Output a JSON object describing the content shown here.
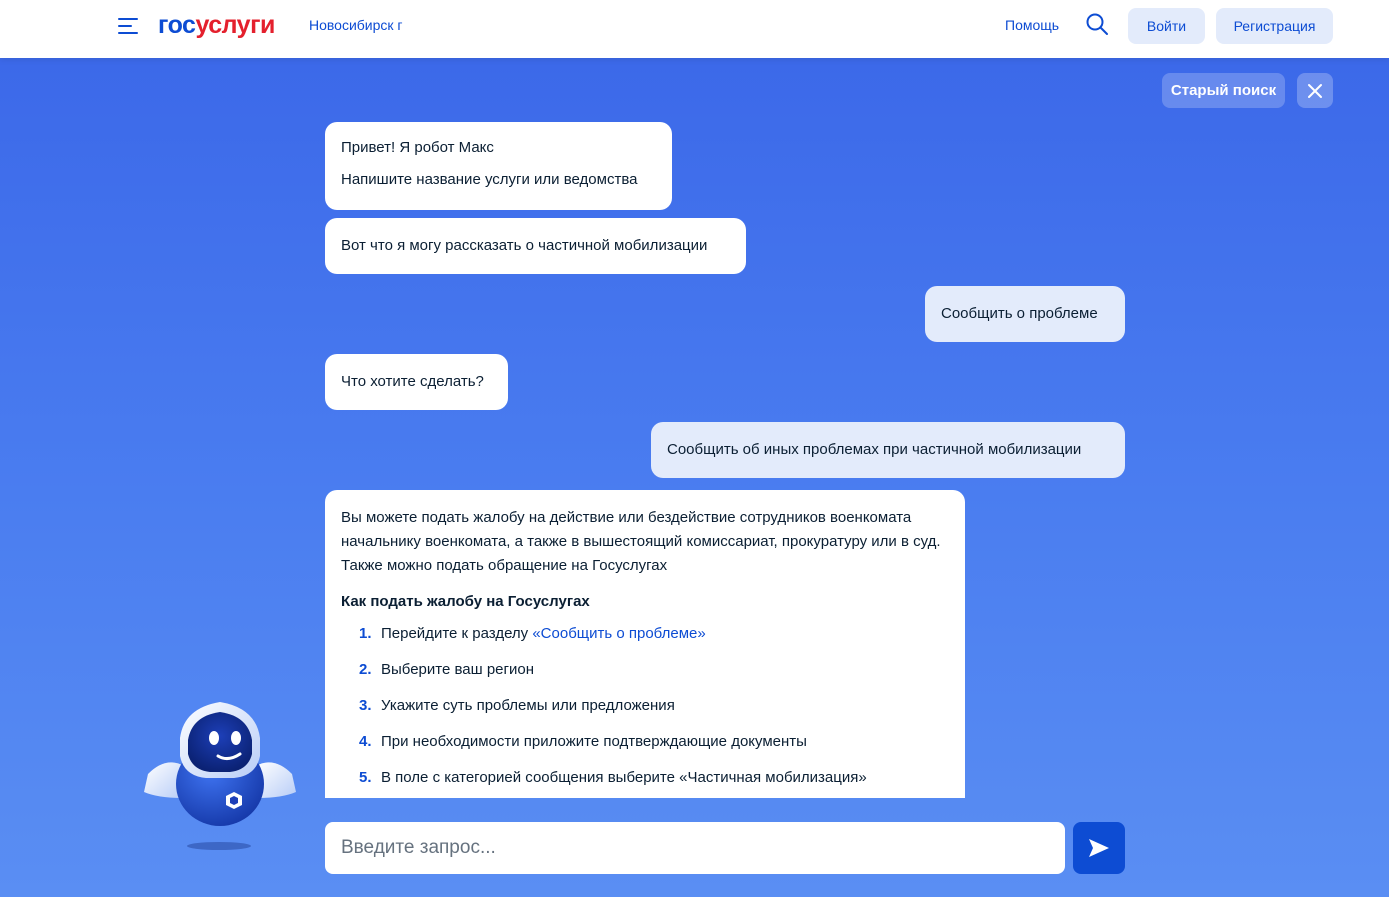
{
  "header": {
    "logo_part1": "гос",
    "logo_part2": "услуги",
    "city": "Новосибирск г",
    "help": "Помощь",
    "login": "Войти",
    "register": "Регистрация"
  },
  "controls": {
    "old_search": "Старый поиск"
  },
  "chat": {
    "bot_greeting": [
      "Привет! Я робот Макс",
      "Напишите название услуги или ведомства"
    ],
    "bot_topic": "Вот что я могу рассказать о частичной мобилизации",
    "user_choice_1": "Сообщить о проблеме",
    "bot_question": "Что хотите сделать?",
    "user_choice_2": "Сообщить об иных проблемах при частичной мобилизации",
    "answer": {
      "paragraph": "Вы можете подать жалобу на действие или бездействие сотрудников военкомата начальнику военкомата, а также в вышестоящий комиссариат, прокуратуру или в суд. Также можно подать обращение на Госуслугах",
      "heading": "Как подать жалобу на Госуслугах",
      "steps": [
        {
          "num": "1.",
          "text": "Перейдите к разделу ",
          "link": "«Сообщить о проблеме»"
        },
        {
          "num": "2.",
          "text": "Выберите ваш регион"
        },
        {
          "num": "3.",
          "text": "Укажите суть проблемы или предложения"
        },
        {
          "num": "4.",
          "text": "При необходимости приложите подтверждающие документы"
        },
        {
          "num": "5.",
          "text": "В поле с категорией сообщения выберите «Частичная мобилизация»"
        }
      ]
    }
  },
  "input": {
    "placeholder": "Введите запрос..."
  },
  "icons": {
    "menu": "menu-icon",
    "search": "search-icon",
    "close": "close-icon",
    "send": "send-icon",
    "robot": "robot-max-avatar"
  },
  "colors": {
    "brand_blue": "#0d4cd3",
    "brand_red": "#e4202d",
    "background": "#3a66e8",
    "user_bubble": "#e3ebfb"
  }
}
